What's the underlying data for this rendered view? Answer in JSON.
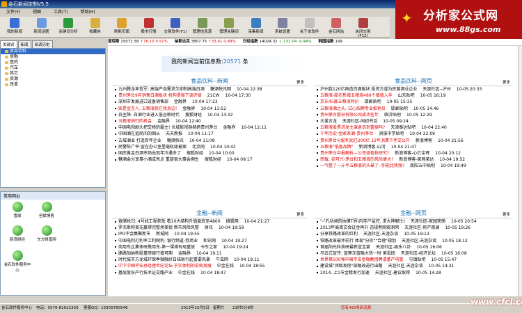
{
  "window_title": "金石新闻定制V5.5",
  "menu": [
    "文件(F)",
    "视图",
    "工具(T)",
    "帮助(H)"
  ],
  "toolbar": [
    {
      "label": "我的新闻",
      "color": "#3b6fd8",
      "icon": "user-news-icon"
    },
    {
      "label": "新闻话题",
      "color": "#6a9be0",
      "icon": "topic-icon"
    },
    {
      "label": "关键词分析",
      "color": "#2a9a3a",
      "icon": "chart-icon"
    },
    {
      "label": "收藏夹",
      "color": "#d8b040",
      "icon": "folder-icon"
    },
    {
      "label": "刷新页面",
      "color": "#e0a030",
      "icon": "refresh-icon"
    },
    {
      "label": "股市行情",
      "color": "#c03030",
      "icon": "stock-icon"
    },
    {
      "label": "交易软件(F1)",
      "color": "#4060c0",
      "icon": "trade-icon"
    },
    {
      "label": "管理信息源",
      "color": "#7a9a5a",
      "icon": "source-icon"
    },
    {
      "label": "管理关键词",
      "color": "#8aa050",
      "icon": "keyword-icon"
    },
    {
      "label": "采集新闻",
      "color": "#3a80c0",
      "icon": "collect-icon"
    },
    {
      "label": "系统设置",
      "color": "#8080a0",
      "icon": "settings-icon"
    },
    {
      "label": "关于本软件",
      "color": "#c0c0c0",
      "icon": "about-icon"
    },
    {
      "label": "金石网站",
      "color": "#d06060",
      "icon": "home-icon"
    },
    {
      "label": "关闭交易(F12)",
      "color": "#b04040",
      "icon": "close-trade-icon"
    }
  ],
  "brand": {
    "title": "分析家公式网",
    "url": "www.88gs.com"
  },
  "ticker": [
    {
      "name": "道琼斯",
      "value": "15072.58",
      "chg": "↑78.10",
      "pct": "0.51%",
      "cls": "r"
    },
    {
      "name": "纳斯达克",
      "value": "3807.75",
      "chg": "↑33.41",
      "pct": "0.89%",
      "cls": "r"
    },
    {
      "name": "日经指数",
      "value": "14024.31",
      "chg": "↓-132.04",
      "pct": "-0.94%",
      "cls": "g"
    },
    {
      "name": "韩国指数",
      "value": "199",
      "chg": "",
      "pct": "",
      "cls": ""
    }
  ],
  "left_tabs": [
    "关键词",
    "新闻",
    "阅读历史"
  ],
  "tree": [
    "食品饮料",
    "金融",
    "医药",
    "汽车",
    "其它",
    "资源",
    "改革"
  ],
  "common": {
    "header": "常用网址",
    "items": [
      "雪球",
      "但斌博客",
      "新浪财经",
      "东方财富网",
      "金石软件服务中心"
    ]
  },
  "banner": {
    "prefix": "我的新闻当前信息数:",
    "count": "20571",
    "suffix": "条"
  },
  "sections": [
    {
      "title": "食品饮料--新闻",
      "more": "更多",
      "items": [
        {
          "t": "九州腾龙丰哲军: 高端产品需求欠抑制高端白酒",
          "s": "糖酒快讯网",
          "d": "10-04 22:38"
        },
        {
          "t": "贵州茅台9月销售白酒板块 机构提振下调评级",
          "s": "21CW",
          "d": "10-04 17:30",
          "red": "贵州茅台"
        },
        {
          "t": "深圳市发展进口设备销售部",
          "s": "金融界",
          "d": "10-04 17:23"
        },
        {
          "t": "凯是宣言人, 五粮液就在我身边!",
          "s": "金融界",
          "d": "10-04 13:52",
          "red": "五粮液"
        },
        {
          "t": "白主降: 白酒行业进入低谷新时代",
          "s": "搜狐财经",
          "d": "10-04 13:32"
        },
        {
          "t": "五粮液销行的机会",
          "s": "金融界",
          "d": "10-04 12:40",
          "red": "五粮液"
        },
        {
          "t": "中国电视剧头把交椅的霸主! 长城影视赫赫跨贵州茅台",
          "s": "金融界",
          "d": "10-04 12:11"
        },
        {
          "t": "中国酒在追民间的困从",
          "s": "天天新报",
          "d": "10-04 11:17"
        },
        {
          "t": "古城酒业 打造百年企业",
          "s": "糖酒快讯",
          "d": "10-04 11:08"
        },
        {
          "t": "民警陈广平:宣在办公室里毫轨级被案",
          "s": "北京网",
          "d": "10-04 10:42"
        },
        {
          "t": "国庆黄金白酒市场出现年冷遇多了",
          "s": "搜狐财经",
          "d": "10-04 10:00"
        },
        {
          "t": "糖酒会分享事小酒成亮点 重链很大事会拥生",
          "s": "搜狐财经",
          "d": "10-04 09:17"
        }
      ]
    },
    {
      "title": "食品饮料--网页",
      "more": "更多",
      "items": [
        {
          "t": "泸州我120亿再造白酒板块 投资方或为民营酒业企业",
          "s": "天涯社区--泸州",
          "d": "10-05 20:33"
        },
        {
          "t": "五粮液-股在新增五粮液489个增值入手",
          "s": "山东贴吧",
          "d": "10-05 16:19",
          "red": "五粮液"
        },
        {
          "t": "京东45度五粮液特价",
          "s": "邯郸贴吧",
          "d": "10-05 15:35",
          "red": "五粮液"
        },
        {
          "t": "五粮液酒之头, 试心招聘专业推销员",
          "s": "邯郸贴吧",
          "d": "10-05 14:46",
          "red": "五粮液"
        },
        {
          "t": "贵州茅台股份有限公司成功往年",
          "s": "临沂贴吧",
          "d": "10-05 12:29",
          "red": "贵州茅台"
        },
        {
          "t": "大爱古龙",
          "s": "天涯社区-闲初书话",
          "d": "10-05 09:24"
        },
        {
          "t": "五粮液股票进发主课退说到重接吗?",
          "s": "天津泰达贴吧",
          "d": "10-04 22:40",
          "red": "五粮液"
        },
        {
          "t": "千年历史-金家茶酒-贵州茅台",
          "s": "洞溪中学贴吧",
          "d": "10-04 22:09",
          "red": "贵州茅台"
        },
        {
          "t": "贵州茅台分配利润已200亿 12年消费下手交公开",
          "s": "新浪博客",
          "d": "10-04 21:56",
          "red": "贵州茅台"
        },
        {
          "t": "五粮液\"低度品牌\"",
          "s": "新浪博客-山河",
          "d": "10-04 21:47",
          "red": "五粮液"
        },
        {
          "t": "贵州茅台中报解析—公司调查技研究?",
          "s": "新浪博客-心灯余辉",
          "d": "10-04 20:12",
          "red": "贵州茅台"
        },
        {
          "t": "转载: 张可兴-茅台和五粮液的风险更大?",
          "s": "新浪博客-家燕美达",
          "d": "10-04 19:52",
          "red": "五粮液"
        },
        {
          "t": "一气整了一斤半五粮液的头晕了, 你能比我强?",
          "s": "南阳五中贴吧",
          "d": "10-04 19:49",
          "red": "五粮液"
        }
      ]
    },
    {
      "title": "金融--新闻",
      "more": "更多",
      "items": [
        {
          "t": "银储抢归: 4号线工程获批 看10大结构升值盘底至4800",
          "s": "搜狐网",
          "d": "10-04 21:27"
        },
        {
          "t": "罗杰斯称美无赢得完整场美锐 新市风险风整",
          "s": "财讯",
          "d": "10-04 19:59"
        },
        {
          "t": "IPO不会集聚新市",
          "s": "新城网",
          "d": "10-04 19:55"
        },
        {
          "t": "中国电利刃利率工利网利: 银行频道-券商业",
          "s": "和讯网",
          "d": "10-04 19:27"
        },
        {
          "t": "商用车企集体研携用车-第一课增有局重放",
          "s": "卡车之家",
          "d": "10-04 19:24"
        },
        {
          "t": "路路加纳新股重磅银行值可期",
          "s": "金融界",
          "d": "10-04 19:11"
        },
        {
          "t": "时代城市方龙城环保季微融好日结助引起重要风暴",
          "s": "牛虫网",
          "d": "10-04 19:11"
        },
        {
          "t": "中下中国平安总经理世纪论坛 于实体制的宏观发展",
          "s": "中金在线",
          "d": "10-04 18:55",
          "red": "中国平安"
        },
        {
          "t": "基层股份产行技术证交路产业",
          "s": "中金在线",
          "d": "10-04 18:47"
        }
      ]
    },
    {
      "title": "金融--网页",
      "more": "更多",
      "items": [
        {
          "t": "\"-\"孔功昶的执模T界(内存户监控, 求大神解忙)",
          "s": "天涯社区-家园荣荫",
          "d": "10-05 20:54"
        },
        {
          "t": "2013年高密交会证金再升 违规者刚观测网",
          "s": "天涯社区-房产观澜",
          "d": "10-05 19:26"
        },
        {
          "t": "分享铁路改革的红利",
          "s": "天涯社区-天涯杂谈",
          "d": "10-05 19:13"
        },
        {
          "t": "铁路改革破坏前行 体现\"分拆\"\"合理\"规划",
          "s": "天涯社区-天涯杂谈",
          "d": "10-05 18:12"
        },
        {
          "t": "首届阳光科技研最新宣宝宴",
          "s": "天涯社区-娱乐八卦",
          "d": "10-05 16:06"
        },
        {
          "t": "马云式宣传: 蓝筹次蓝融大热一时 美投团",
          "s": "天涯社区-经济论坛",
          "d": "10-05 16:08"
        },
        {
          "t": "世界第500强中国平安金融集团聘请基产电管",
          "s": "屯镇贴吧",
          "d": "10-05 15:47",
          "red": "中国平安"
        },
        {
          "t": "建设城\"闭观发房\"部融改进行出路",
          "s": "天涯社区-天涯杂谈",
          "d": "10-05 14:31"
        },
        {
          "t": "2014, 上1节金精发行加速",
          "s": "天涯社区-建议取得",
          "d": "10-05 14:28"
        }
      ]
    }
  ],
  "status": {
    "service": "金石软件服务中心",
    "phone": "电话：0576-81622303",
    "qq": "客服QQ：13305760546",
    "date": "2013年10月5日",
    "weekday": "星期六",
    "time": "21时5分8秒",
    "new": "您有495条新消息",
    "watermark": "www.cfcl.com"
  }
}
